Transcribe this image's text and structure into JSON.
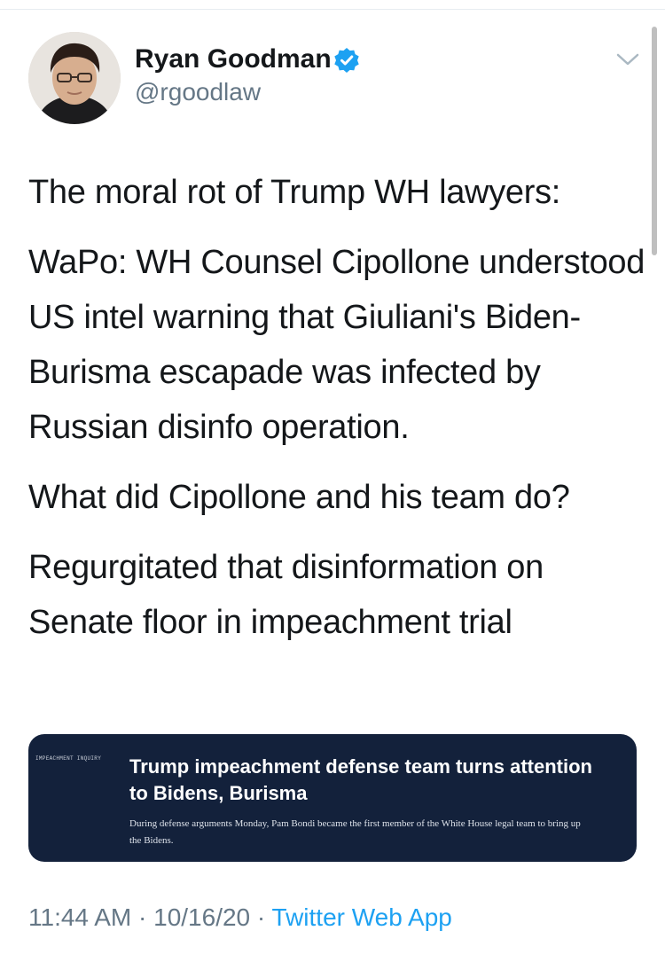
{
  "author": {
    "name": "Ryan Goodman",
    "handle": "@rgoodlaw",
    "verified": true
  },
  "tweet": {
    "paragraphs": [
      "The moral rot of Trump WH lawyers:",
      "WaPo: WH Counsel Cipollone understood US intel warning that Giuliani's Biden-Burisma escapade was infected by Russian disinfo operation.",
      "What did Cipollone and his team do?",
      "Regurgitated that disinformation on Senate floor in impeachment trial"
    ]
  },
  "card": {
    "kicker": "IMPEACHMENT INQUIRY",
    "title": "Trump impeachment defense team turns attention to Bidens, Burisma",
    "description": "During defense arguments Monday, Pam Bondi became the first member of the White House legal team to bring up the Bidens."
  },
  "meta": {
    "time": "11:44 AM",
    "separator": "·",
    "date": "10/16/20",
    "app": "Twitter Web App"
  },
  "icons": {
    "verified": "verified-badge-icon",
    "menu": "chevron-down-icon"
  },
  "colors": {
    "accent": "#1da1f2",
    "text": "#14171a",
    "secondary": "#657786",
    "card_background": "#13213b"
  }
}
